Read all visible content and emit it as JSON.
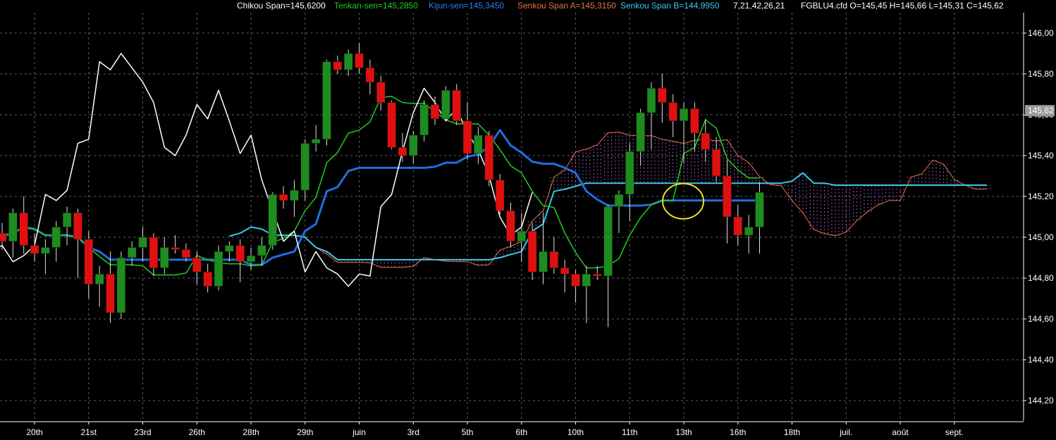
{
  "header": {
    "chikou": "Chikou Span=145,6200",
    "tenkan": "Tenkan-sen=145,2850",
    "kijun": "Kijun-sen=145,3450",
    "senkou_a": "Senkou Span A=145,3150",
    "senkou_b": "Senkou Span B=144,9950",
    "params": "7,21,42,26,21",
    "symbol_ohlc": "FGBLU4.cfd O=145,45 H=145,66 L=145,31 C=145,62"
  },
  "chart_data": {
    "type": "candlestick",
    "ylim": [
      144.1,
      146.1
    ],
    "yticks": [
      "146,00",
      "145,80",
      "145,60",
      "145,40",
      "145,20",
      "145,00",
      "144,80",
      "144,60",
      "144,40",
      "144,20"
    ],
    "ytick_values": [
      146.0,
      145.8,
      145.6,
      145.4,
      145.2,
      145.0,
      144.8,
      144.6,
      144.4,
      144.2
    ],
    "last_price_label": "145,62",
    "last_price": 145.62,
    "xticks": [
      {
        "i": 3,
        "label": "20th"
      },
      {
        "i": 8,
        "label": "21st"
      },
      {
        "i": 13,
        "label": "23rd"
      },
      {
        "i": 18,
        "label": "26th"
      },
      {
        "i": 23,
        "label": "28th"
      },
      {
        "i": 28,
        "label": "29th"
      },
      {
        "i": 33,
        "label": "juin"
      },
      {
        "i": 38,
        "label": "3rd"
      },
      {
        "i": 43,
        "label": "5th"
      },
      {
        "i": 48,
        "label": "6th"
      },
      {
        "i": 53,
        "label": "10th"
      },
      {
        "i": 58,
        "label": "11th"
      },
      {
        "i": 63,
        "label": "13th"
      },
      {
        "i": 68,
        "label": "16th"
      },
      {
        "i": 73,
        "label": "18th"
      },
      {
        "i": 78,
        "label": "juil."
      },
      {
        "i": 83,
        "label": "août"
      },
      {
        "i": 88,
        "label": "sept."
      }
    ],
    "colors": {
      "up": "#1e8c1e",
      "down": "#e01010",
      "chikou": "#ffffff",
      "tenkan": "#22cc22",
      "kijun": "#1e6fe0",
      "senkou_a": "#e8734a",
      "senkou_b": "#3cc8e8",
      "cloud": "#b070e0",
      "highlight": "#f0e020",
      "grid": "#606060"
    },
    "candles": [
      [
        145.02,
        145.07,
        144.94,
        144.98
      ],
      [
        144.98,
        145.14,
        144.9,
        145.12
      ],
      [
        145.12,
        145.2,
        144.92,
        144.96
      ],
      [
        144.96,
        145.02,
        144.88,
        144.92
      ],
      [
        144.92,
        144.99,
        144.82,
        144.95
      ],
      [
        144.95,
        145.08,
        144.88,
        145.05
      ],
      [
        145.05,
        145.15,
        144.96,
        145.12
      ],
      [
        145.12,
        145.14,
        144.8,
        144.99
      ],
      [
        144.99,
        145.03,
        144.7,
        144.77
      ],
      [
        144.77,
        144.86,
        144.66,
        144.82
      ],
      [
        144.82,
        144.93,
        144.58,
        144.63
      ],
      [
        144.63,
        144.93,
        144.6,
        144.9
      ],
      [
        144.9,
        144.98,
        144.86,
        144.95
      ],
      [
        144.95,
        145.05,
        144.88,
        145.0
      ],
      [
        145.0,
        145.02,
        144.81,
        144.85
      ],
      [
        144.85,
        145.0,
        144.82,
        144.95
      ],
      [
        144.95,
        145.01,
        144.92,
        144.94
      ],
      [
        144.94,
        144.97,
        144.88,
        144.9
      ],
      [
        144.9,
        144.93,
        144.77,
        144.83
      ],
      [
        144.83,
        144.87,
        144.73,
        144.76
      ],
      [
        144.76,
        144.96,
        144.74,
        144.93
      ],
      [
        144.93,
        144.98,
        144.88,
        144.96
      ],
      [
        144.96,
        144.99,
        144.78,
        144.88
      ],
      [
        144.88,
        144.95,
        144.84,
        144.91
      ],
      [
        144.91,
        145.0,
        144.86,
        144.96
      ],
      [
        144.96,
        145.22,
        144.94,
        145.21
      ],
      [
        145.21,
        145.25,
        145.14,
        145.18
      ],
      [
        145.18,
        145.28,
        145.1,
        145.23
      ],
      [
        145.23,
        145.48,
        145.18,
        145.46
      ],
      [
        145.46,
        145.55,
        145.42,
        145.48
      ],
      [
        145.48,
        145.87,
        145.45,
        145.86
      ],
      [
        145.86,
        145.89,
        145.8,
        145.82
      ],
      [
        145.82,
        145.92,
        145.79,
        145.9
      ],
      [
        145.9,
        145.95,
        145.8,
        145.83
      ],
      [
        145.83,
        145.87,
        145.7,
        145.76
      ],
      [
        145.76,
        145.79,
        145.62,
        145.66
      ],
      [
        145.66,
        145.67,
        145.43,
        145.44
      ],
      [
        145.44,
        145.51,
        145.37,
        145.4
      ],
      [
        145.4,
        145.52,
        145.36,
        145.5
      ],
      [
        145.5,
        145.67,
        145.47,
        145.65
      ],
      [
        145.65,
        145.69,
        145.55,
        145.58
      ],
      [
        145.58,
        145.74,
        145.57,
        145.72
      ],
      [
        145.72,
        145.75,
        145.55,
        145.57
      ],
      [
        145.57,
        145.66,
        145.38,
        145.41
      ],
      [
        145.41,
        145.54,
        145.36,
        145.5
      ],
      [
        145.5,
        145.52,
        145.25,
        145.28
      ],
      [
        145.28,
        145.31,
        145.11,
        145.13
      ],
      [
        145.13,
        145.17,
        144.95,
        144.98
      ],
      [
        144.98,
        145.12,
        144.88,
        145.03
      ],
      [
        145.03,
        145.07,
        144.79,
        144.83
      ],
      [
        144.83,
        145.12,
        144.77,
        144.93
      ],
      [
        144.93,
        145.0,
        144.82,
        144.85
      ],
      [
        144.85,
        144.89,
        144.73,
        144.82
      ],
      [
        144.82,
        144.84,
        144.68,
        144.76
      ],
      [
        144.76,
        144.86,
        144.58,
        144.82
      ],
      [
        144.82,
        144.86,
        144.79,
        144.81
      ],
      [
        144.81,
        145.16,
        144.56,
        145.15
      ],
      [
        145.15,
        145.23,
        145.02,
        145.21
      ],
      [
        145.21,
        145.46,
        145.08,
        145.42
      ],
      [
        145.42,
        145.63,
        145.35,
        145.61
      ],
      [
        145.61,
        145.76,
        145.43,
        145.73
      ],
      [
        145.73,
        145.8,
        145.56,
        145.66
      ],
      [
        145.66,
        145.7,
        145.49,
        145.57
      ],
      [
        145.57,
        145.66,
        145.36,
        145.63
      ],
      [
        145.63,
        145.66,
        145.42,
        145.51
      ],
      [
        145.51,
        145.58,
        145.37,
        145.43
      ],
      [
        145.43,
        145.49,
        145.27,
        145.3
      ],
      [
        145.3,
        145.38,
        144.97,
        145.1
      ],
      [
        145.1,
        145.16,
        144.96,
        145.01
      ],
      [
        145.01,
        145.11,
        144.92,
        145.05
      ],
      [
        145.05,
        145.27,
        144.92,
        145.22
      ]
    ]
  }
}
